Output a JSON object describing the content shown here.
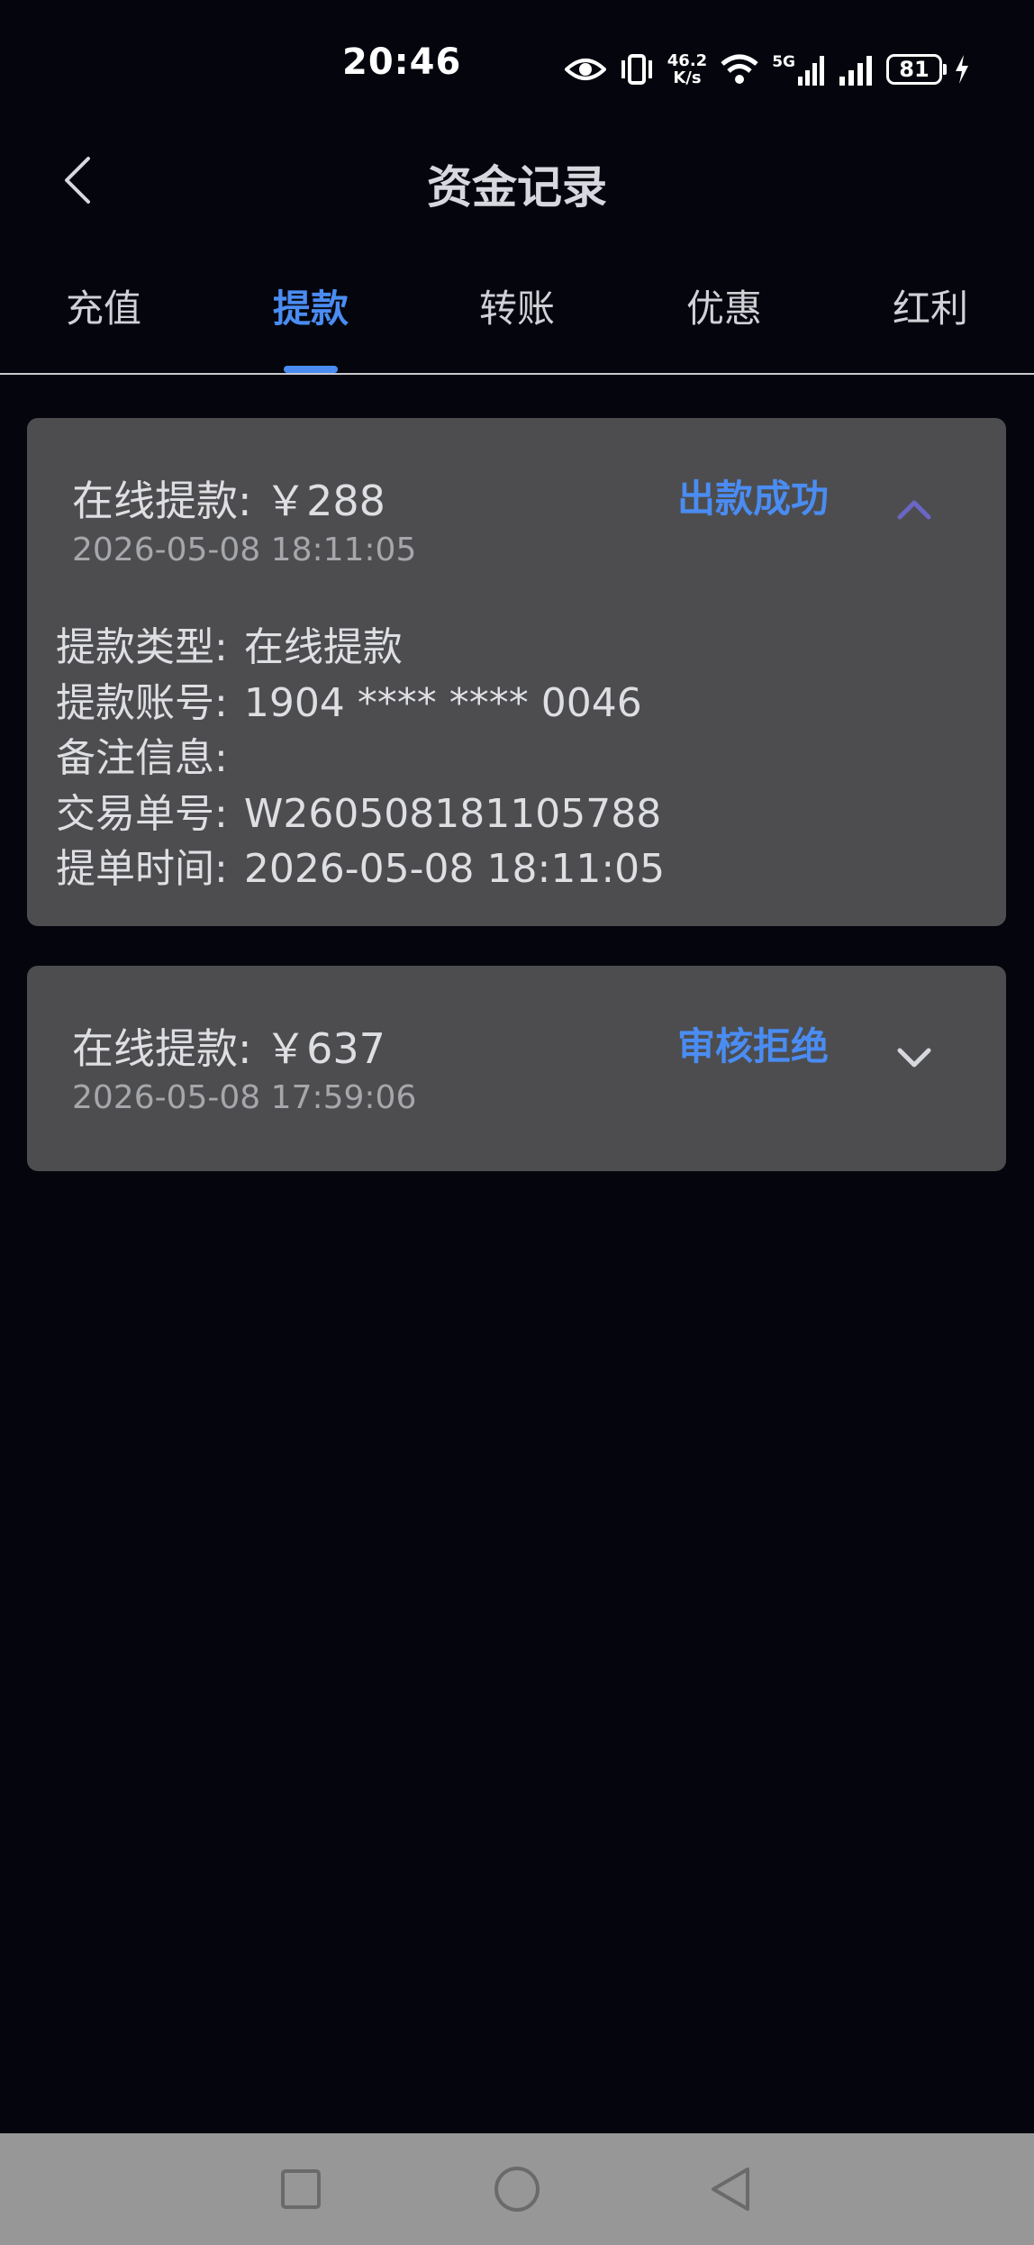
{
  "status_bar": {
    "time": "20:46",
    "net_speed_value": "46.2",
    "net_speed_unit": "K/s",
    "signal_label": "5G",
    "battery": "81",
    "icons": [
      "eye-icon",
      "vibrate-icon",
      "wifi-icon",
      "signal-5g-icon",
      "signal-icon",
      "battery-icon",
      "charging-icon"
    ]
  },
  "header": {
    "title": "资金记录",
    "back_icon": "chevron-left-icon"
  },
  "tabs": [
    {
      "label": "充值",
      "active": false
    },
    {
      "label": "提款",
      "active": true
    },
    {
      "label": "转账",
      "active": false
    },
    {
      "label": "优惠",
      "active": false
    },
    {
      "label": "红利",
      "active": false
    }
  ],
  "records": [
    {
      "title": "在线提款: ￥288",
      "date": "2026-05-08 18:11:05",
      "status": "出款成功",
      "expanded": true,
      "chevron_icon": "chevron-up-icon",
      "details": [
        {
          "label": "提款类型:",
          "value": "在线提款"
        },
        {
          "label": "提款账号:",
          "value": "1904 **** **** 0046"
        },
        {
          "label": "备注信息:",
          "value": ""
        },
        {
          "label": "交易单号:",
          "value": "W260508181105788"
        },
        {
          "label": "提单时间:",
          "value": "2026-05-08 18:11:05"
        }
      ]
    },
    {
      "title": "在线提款: ￥637",
      "date": "2026-05-08 17:59:06",
      "status": "审核拒绝",
      "expanded": false,
      "chevron_icon": "chevron-down-icon"
    }
  ],
  "colors": {
    "background": "#05060d",
    "card": "#4d4d4f",
    "accent": "#4a8cf2",
    "nav_bar": "#979797"
  },
  "nav_bar": {
    "icons": [
      "recent-apps-icon",
      "home-icon",
      "back-icon"
    ]
  }
}
